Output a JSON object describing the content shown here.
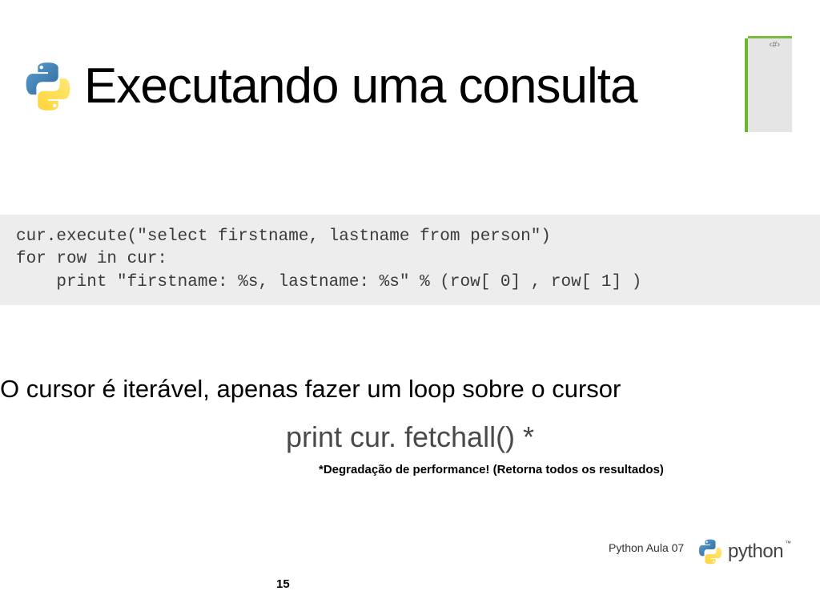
{
  "header": {
    "title": "Executando uma consulta",
    "page_indicator": "‹#›"
  },
  "code": {
    "content": "cur.execute(\"select firstname, lastname from person\")\nfor row in cur:\n    print \"firstname: %s, lastname: %s\" % (row[ 0] , row[ 1] )"
  },
  "body": {
    "cursor_text": "O cursor é iterável, apenas fazer um loop sobre o cursor",
    "print_line": "print cur. fetchall() *",
    "footnote": "*Degradação de performance! (Retorna  todos os resultados)"
  },
  "footer": {
    "label": "Python Aula 07",
    "logo_word": "python",
    "tm": "™",
    "slide_number": "15"
  }
}
